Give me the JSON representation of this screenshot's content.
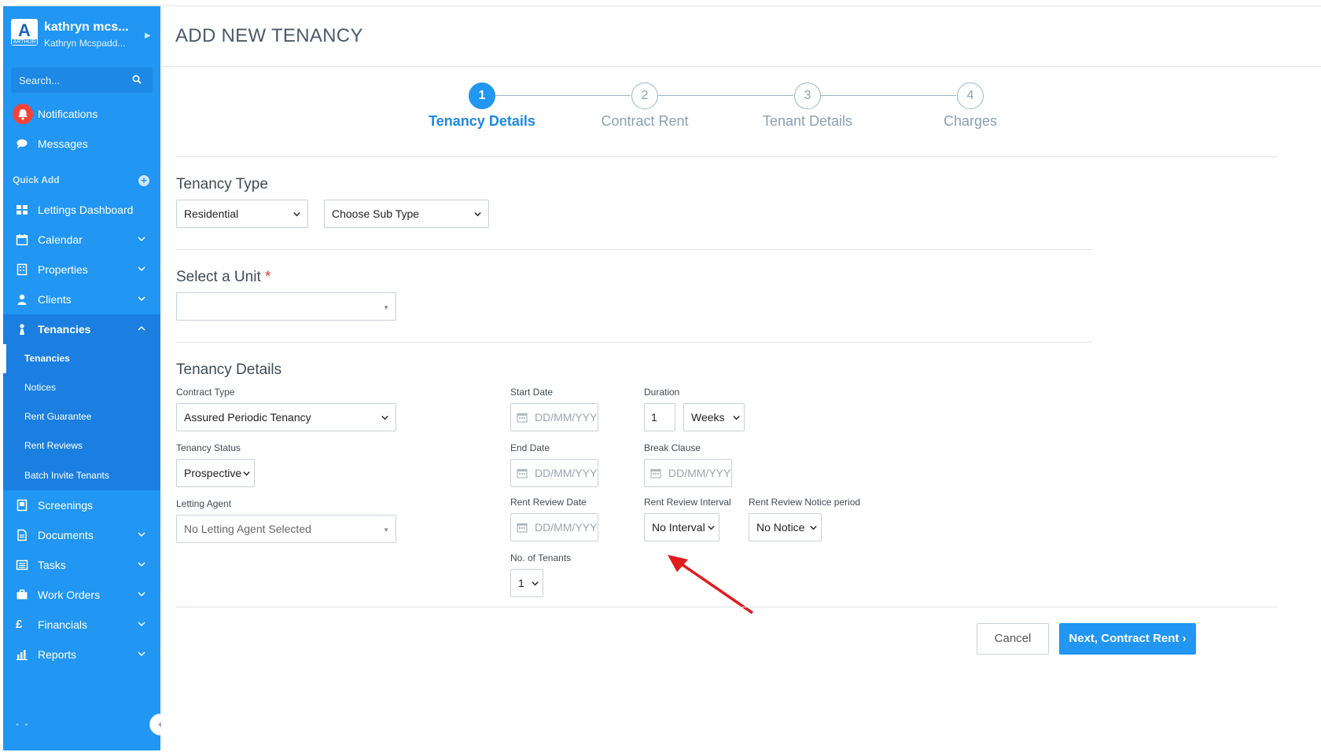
{
  "sidebar": {
    "user_short": "kathryn mcs...",
    "user_full": "Kathryn Mcspadd...",
    "logo_letter": "A",
    "logo_text": "ARTHUR",
    "search_placeholder": "Search...",
    "notifications_label": "Notifications",
    "messages_label": "Messages",
    "quick_add_label": "Quick Add",
    "items": [
      {
        "label": "Lettings Dashboard"
      },
      {
        "label": "Calendar"
      },
      {
        "label": "Properties"
      },
      {
        "label": "Clients"
      },
      {
        "label": "Tenancies"
      },
      {
        "label": "Screenings"
      },
      {
        "label": "Documents"
      },
      {
        "label": "Tasks"
      },
      {
        "label": "Work Orders"
      },
      {
        "label": "Financials"
      },
      {
        "label": "Reports"
      }
    ],
    "tenancies_sub": [
      "Tenancies",
      "Notices",
      "Rent Guarantee",
      "Rent Reviews",
      "Batch Invite Tenants"
    ],
    "more_dots": "- -",
    "accent": "#2196f3"
  },
  "page": {
    "title": "ADD NEW TENANCY"
  },
  "steps": [
    {
      "num": "1",
      "label": "Tenancy Details"
    },
    {
      "num": "2",
      "label": "Contract Rent"
    },
    {
      "num": "3",
      "label": "Tenant Details"
    },
    {
      "num": "4",
      "label": "Charges"
    }
  ],
  "tenancy_type": {
    "title": "Tenancy Type",
    "type_value": "Residential",
    "subtype_value": "Choose Sub Type"
  },
  "unit": {
    "title": "Select a Unit",
    "required_mark": "*",
    "value": ""
  },
  "details": {
    "title": "Tenancy Details",
    "contract_type_label": "Contract Type",
    "contract_type_value": "Assured Periodic Tenancy",
    "status_label": "Tenancy Status",
    "status_value": "Prospective",
    "agent_label": "Letting Agent",
    "agent_value": "No Letting Agent Selected",
    "start_label": "Start Date",
    "end_label": "End Date",
    "review_date_label": "Rent Review Date",
    "tenants_label": "No. of Tenants",
    "tenants_value": "1",
    "duration_label": "Duration",
    "duration_value": "1",
    "duration_unit": "Weeks",
    "break_label": "Break Clause",
    "interval_label": "Rent Review Interval",
    "interval_value": "No Interval",
    "notice_label": "Rent Review Notice period",
    "notice_value": "No Notice",
    "date_placeholder": "DD/MM/YYYY"
  },
  "actions": {
    "cancel": "Cancel",
    "next": "Next, Contract Rent ›"
  }
}
